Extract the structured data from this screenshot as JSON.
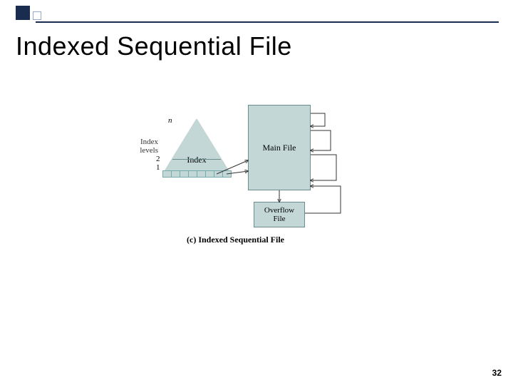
{
  "title": "Indexed Sequential File",
  "index": {
    "label": "Index",
    "levels_label": "Index\nlevels",
    "level_n": "n",
    "level_2": "2",
    "level_1": "1"
  },
  "main_file_label": "Main File",
  "overflow_label": "Overflow\nFile",
  "caption": "(c) Indexed Sequential File",
  "page_number": "32"
}
